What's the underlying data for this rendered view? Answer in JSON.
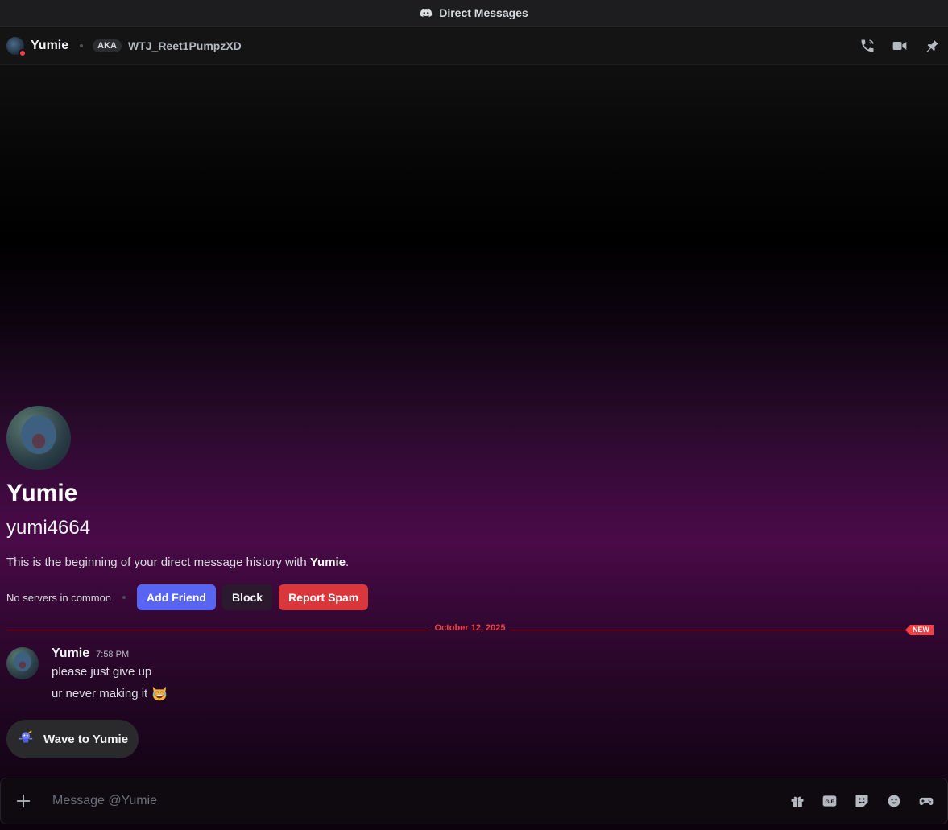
{
  "window": {
    "title": "Direct Messages"
  },
  "header": {
    "name": "Yumie",
    "aka_label": "AKA",
    "aka_name": "WTJ_Reet1PumpzXD",
    "status_color": "#f23f43",
    "actions": [
      "call-icon",
      "video-icon",
      "pin-icon"
    ]
  },
  "intro": {
    "display_name": "Yumie",
    "username": "yumi4664",
    "description_prefix": "This is the beginning of your direct message history with ",
    "description_name": "Yumie",
    "description_suffix": ".",
    "mutual": "No servers in common",
    "buttons": {
      "add_friend": "Add Friend",
      "block": "Block",
      "report_spam": "Report Spam"
    }
  },
  "divider": {
    "date": "October 12, 2025",
    "badge": "NEW"
  },
  "message": {
    "author": "Yumie",
    "time": "7:58 PM",
    "line1": "please just give up",
    "line2": "ur never making it",
    "emoji": "joy-cat-emoji"
  },
  "wave": {
    "label": "Wave to Yumie"
  },
  "composer": {
    "placeholder": "Message @Yumie",
    "tools": [
      "gift-icon",
      "gif-icon",
      "sticker-icon",
      "emoji-icon",
      "activity-icon"
    ]
  },
  "colors": {
    "accent": "#5865f2",
    "danger": "#da373c",
    "new": "#f23f43"
  }
}
